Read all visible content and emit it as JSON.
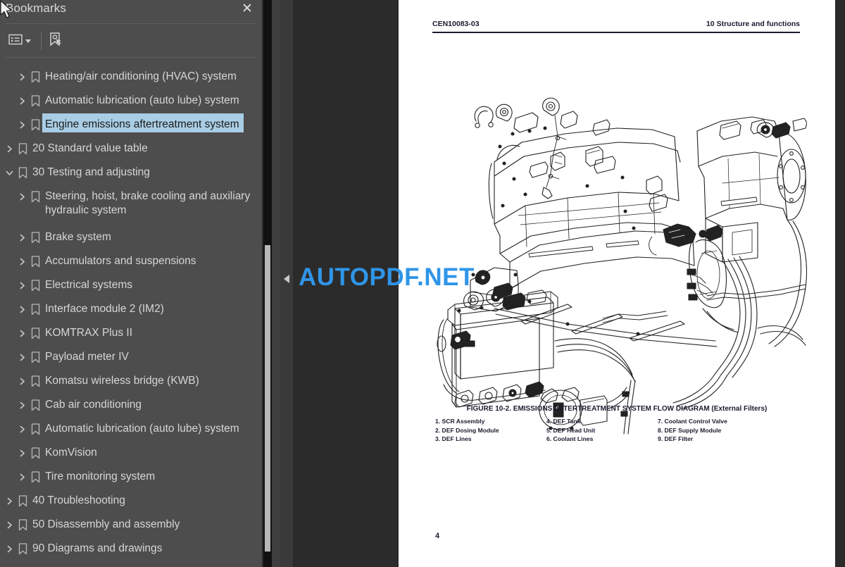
{
  "panel": {
    "title": "Bookmarks",
    "close_label": "✕",
    "toolbar": {
      "list_options_icon": "list-options-icon",
      "list_options_caret": "chevron-down-icon",
      "find_bookmark_icon": "find-bookmark-icon"
    }
  },
  "tree": {
    "items": [
      {
        "label": "Heating/air conditioning (HVAC) system",
        "level": 2,
        "expanded": false,
        "selected": false
      },
      {
        "label": "Automatic lubrication (auto lube) system",
        "level": 2,
        "expanded": false,
        "selected": false
      },
      {
        "label": "Engine emissions aftertreatment system",
        "level": 2,
        "expanded": false,
        "selected": true
      },
      {
        "label": "20 Standard value table",
        "level": 1,
        "expanded": false,
        "selected": false
      },
      {
        "label": "30 Testing and adjusting",
        "level": 1,
        "expanded": true,
        "selected": false
      },
      {
        "label": "Steering, hoist, brake cooling and auxiliary hydraulic system",
        "level": 2,
        "expanded": false,
        "selected": false,
        "tall": true
      },
      {
        "label": "Brake system",
        "level": 2,
        "expanded": false,
        "selected": false
      },
      {
        "label": "Accumulators and suspensions",
        "level": 2,
        "expanded": false,
        "selected": false
      },
      {
        "label": "Electrical systems",
        "level": 2,
        "expanded": false,
        "selected": false
      },
      {
        "label": "Interface module 2 (IM2)",
        "level": 2,
        "expanded": false,
        "selected": false
      },
      {
        "label": "KOMTRAX Plus II",
        "level": 2,
        "expanded": false,
        "selected": false
      },
      {
        "label": "Payload meter IV",
        "level": 2,
        "expanded": false,
        "selected": false
      },
      {
        "label": "Komatsu wireless bridge (KWB)",
        "level": 2,
        "expanded": false,
        "selected": false
      },
      {
        "label": "Cab air conditioning",
        "level": 2,
        "expanded": false,
        "selected": false
      },
      {
        "label": "Automatic lubrication (auto lube) system",
        "level": 2,
        "expanded": false,
        "selected": false
      },
      {
        "label": "KomVision",
        "level": 2,
        "expanded": false,
        "selected": false
      },
      {
        "label": "Tire monitoring system",
        "level": 2,
        "expanded": false,
        "selected": false
      },
      {
        "label": "40 Troubleshooting",
        "level": 1,
        "expanded": false,
        "selected": false
      },
      {
        "label": "50 Disassembly and assembly",
        "level": 1,
        "expanded": false,
        "selected": false
      },
      {
        "label": "90 Diagrams and drawings",
        "level": 1,
        "expanded": false,
        "selected": false
      }
    ]
  },
  "collapse_handle": {
    "icon": "chevron-left-icon"
  },
  "document": {
    "header_left": "CEN10083-03",
    "header_right": "10 Structure and functions",
    "figure_caption": "FIGURE 10-2. EMISSIONS AFTERTREATMENT SYSTEM FLOW DIAGRAM (External Filters)",
    "legend_columns": [
      [
        "1. SCR Assembly",
        "2. DEF Dosing Module",
        "3. DEF Lines"
      ],
      [
        "4. DEF Tank",
        "5. DEF Head Unit",
        "6. Coolant Lines"
      ],
      [
        "7. Coolant Control Valve",
        "8. DEF Supply Module",
        "9. DEF Filter"
      ]
    ],
    "page_number": "4"
  },
  "watermark": {
    "text": "AUTOPDF.NET",
    "color": "#2f95e8"
  },
  "colors": {
    "panel_bg": "#4d4d4d",
    "viewer_bg": "#2b2b2b",
    "selection_bg": "#a9cde5",
    "page_bg": "#ffffff",
    "text": "#d6d6d6"
  }
}
